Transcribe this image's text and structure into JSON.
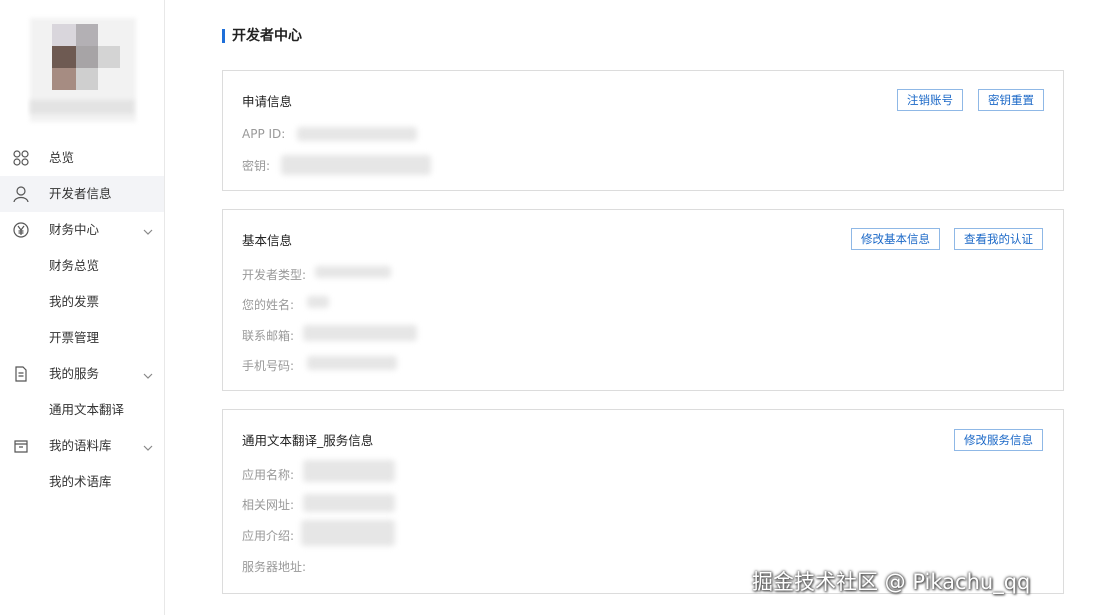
{
  "sidebar": {
    "items": [
      {
        "label": "总览",
        "icon": "grid-icon"
      },
      {
        "label": "开发者信息",
        "icon": "user-icon"
      },
      {
        "label": "财务中心",
        "icon": "yen-icon"
      },
      {
        "label": "财务总览"
      },
      {
        "label": "我的发票"
      },
      {
        "label": "开票管理"
      },
      {
        "label": "我的服务",
        "icon": "document-icon"
      },
      {
        "label": "通用文本翻译"
      },
      {
        "label": "我的语料库",
        "icon": "package-icon"
      },
      {
        "label": "我的术语库"
      }
    ]
  },
  "page": {
    "title": "开发者中心"
  },
  "apply": {
    "title": "申请信息",
    "cancel_button": "注销账号",
    "reset_button": "密钥重置",
    "fields": [
      "APP ID:",
      "密钥:"
    ]
  },
  "basic": {
    "title": "基本信息",
    "edit_button": "修改基本信息",
    "cert_button": "查看我的认证",
    "fields": [
      "开发者类型:",
      "您的姓名:",
      "联系邮箱:",
      "手机号码:"
    ]
  },
  "service": {
    "title": "通用文本翻译_服务信息",
    "edit_button": "修改服务信息",
    "fields": [
      "应用名称:",
      "相关网址:",
      "应用介绍:",
      "服务器地址:"
    ]
  },
  "watermark": "掘金技术社区 @ Pikachu_qq",
  "colors": {
    "accent": "#1e6fd9",
    "button_text": "#1b68c7",
    "active_bg": "#f3f4f7"
  }
}
